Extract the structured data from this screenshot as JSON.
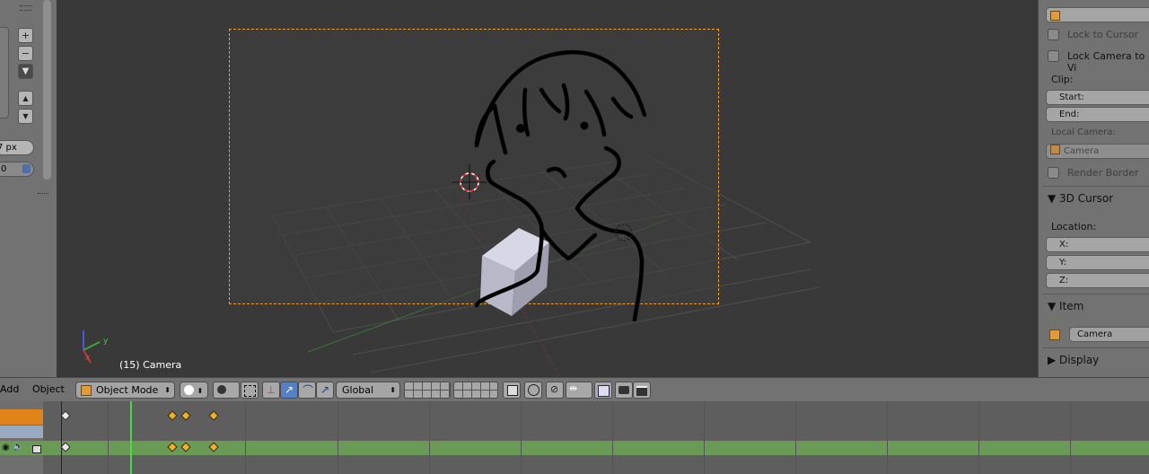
{
  "viewport": {
    "object_label": "(15) Camera",
    "axis_x": "x",
    "axis_y": "y"
  },
  "toolshelf": {
    "plus": "+",
    "minus": "−",
    "up": "▲",
    "down": "▼",
    "size_value": "7 px",
    "num_value": "0"
  },
  "npanel": {
    "lock_to_cursor": "Lock to Cursor",
    "lock_camera": "Lock Camera to Vi",
    "clip_label": "Clip:",
    "clip_start": "Start:",
    "clip_end": "End:",
    "local_camera_label": "Local Camera:",
    "local_camera_value": "Camera",
    "render_border": "Render Border",
    "cursor_section": "▼ 3D Cursor",
    "location_label": "Location:",
    "loc_x": "X:",
    "loc_y": "Y:",
    "loc_z": "Z:",
    "item_section": "▼ Item",
    "item_name": "Camera",
    "display_section": "▶ Display"
  },
  "header": {
    "menu_add": "Add",
    "menu_object": "Object",
    "mode": "Object Mode",
    "orientation": "Global"
  },
  "colors": {
    "accent_selected_key": "#f0b020",
    "channel_active": "#e0841a",
    "channel_green": "#6b9a56",
    "playhead": "#4cd64c",
    "camera_frame": "#f0a030"
  }
}
